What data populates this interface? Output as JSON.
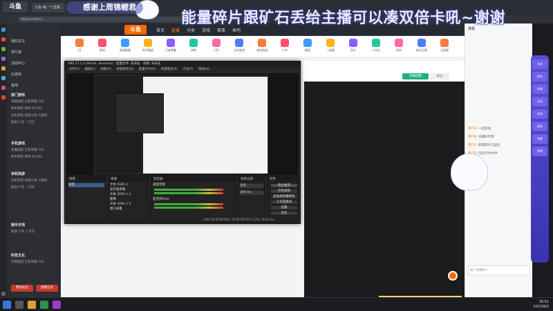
{
  "browser": {
    "logo_text": "斗鱼",
    "tabs": [
      "斗鱼-每一个直播...",
      "斗鱼直播",
      "斗鱼 - 直播间 | 斗..."
    ],
    "url": "douyu.com/..."
  },
  "overlay": {
    "thanks_banner": "感谢上周锦鲤君",
    "main_banner": "能量碎片跟矿石丢给主播可以凑双倍卡吼~谢谢"
  },
  "site_nav": {
    "logo": "斗鱼",
    "items": [
      "首页",
      "直播",
      "分类",
      "游戏",
      "赛事",
      "鱼吧"
    ]
  },
  "category_strip": [
    "12",
    "星秀",
    "英雄联盟",
    "和平精英",
    "王者荣耀",
    "原神",
    "CS2",
    "主机游戏",
    "单机热游",
    "户外",
    "颜值",
    "一起看",
    "音乐",
    "二次元",
    "科技",
    "娱乐天地",
    "正能量"
  ],
  "left_menu": {
    "items": [
      "我的关注",
      "排行榜",
      "活动中心",
      "云游戏",
      "鱼吧"
    ],
    "sections": [
      "热门游戏",
      "手机游戏",
      "单机热游",
      "娱乐天地",
      "科技文化"
    ],
    "grid_rows": [
      "英雄联盟  王者荣耀  CS2",
      "和平精英  原神  DOTA2",
      "主机游戏  穿越火线  三国杀",
      "颜值  户外  二次元"
    ],
    "bottom_buttons": [
      "我的关注",
      "观看历史"
    ]
  },
  "obs": {
    "title": "OBS 27.1.3 (64-bit, windows) - 配置文件: 未命名 - 场景: 未命名",
    "menu": [
      "文件(F)",
      "编辑(E)",
      "视图(V)",
      "停靠部件(D)",
      "配置文件(P)",
      "场景集合(S)",
      "工具(T)",
      "帮助(H)"
    ],
    "docks": {
      "scenes": "场景",
      "sources": "来源",
      "mixer": "混音器",
      "transitions": "场景过渡",
      "controls": "控件"
    },
    "scene_items": [
      "场景"
    ],
    "source_items": [
      "文本 (GDI+)",
      "显示器采集",
      "文本 (GDI+) 2",
      "图像",
      "文本 (GDI+) 3",
      "窗口采集"
    ],
    "mixer_items": [
      "桌面音频",
      "麦克风/Aux"
    ],
    "transition": "淡出",
    "duration": "300 ms",
    "controls": [
      "停止推流",
      "开始录制",
      "启动虚拟摄像机",
      "工作室模式",
      "设置",
      "退出"
    ],
    "status": "LIVE: 00:00:00  REC: 00:00:00  CPU: 2.3%, 30.00 fps"
  },
  "site_actions": {
    "follow": "开播提醒",
    "fav": "关注"
  },
  "chat": {
    "title": "弹幕",
    "messages": [
      {
        "name": "用户A",
        "text": "一起加油"
      },
      {
        "name": "用户B",
        "text": "主播好厉害"
      },
      {
        "name": "用户C",
        "text": "能量碎片已送出"
      },
      {
        "name": "用户D",
        "text": "双倍卡冲冲冲"
      }
    ],
    "input_placeholder": "发个弹幕呗~",
    "gift_strip": "送出了能量碎片x1 谢谢支持"
  },
  "side_panel": [
    "关注",
    "排名",
    "礼物",
    "活动",
    "任务",
    "粉丝",
    "贡献",
    "榜单"
  ],
  "taskbar": {
    "time": "16:51",
    "date": "2023/8/3"
  },
  "colors": {
    "douyu_orange": "#ff6a00",
    "obs_bg": "#2b2b2b",
    "overlay_purple": "#4a3fc8"
  }
}
